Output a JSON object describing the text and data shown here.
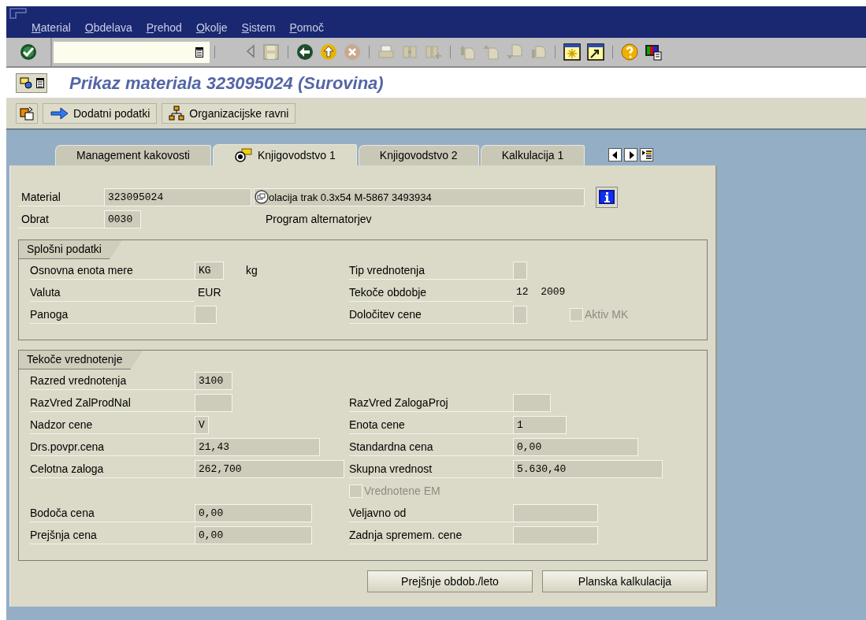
{
  "menu": [
    "Material",
    "Obdelava",
    "Prehod",
    "Okolje",
    "Sistem",
    "Pomoč"
  ],
  "title": "Prikaz materiala 323095024 (Surovina)",
  "app_toolbar": [
    {
      "label": "Dodatni podatki",
      "kind": "arrow"
    },
    {
      "label": "Organizacijske ravni",
      "kind": "hierarchy"
    }
  ],
  "tabs": [
    {
      "label": "Management kakovosti",
      "selected": false
    },
    {
      "label": "Knjigovodstvo 1",
      "selected": true
    },
    {
      "label": "Knjigovodstvo 2",
      "selected": false
    },
    {
      "label": "Kalkulacija 1",
      "selected": false
    }
  ],
  "header": [
    {
      "label": "Material",
      "value": "323095024",
      "description": "olacija trak 0.3x54 M-5867 3493934",
      "kind": "field"
    },
    {
      "label": "Obrat",
      "value": "0030",
      "description": "Program alternatorjev",
      "kind": "text"
    }
  ],
  "groups": [
    {
      "title": "Splošni podatki",
      "rows": [
        {
          "left": {
            "kind": "field",
            "label": "Osnovna enota mere",
            "value": "KG",
            "unit": "kg"
          },
          "right": {
            "kind": "field",
            "label": "Tip vrednotenja"
          }
        },
        {
          "left": {
            "kind": "text",
            "label": "Valuta",
            "value": "EUR"
          },
          "right": {
            "kind": "text",
            "label": "Tekoče obdobje",
            "value": "12  2009"
          }
        },
        {
          "left": {
            "kind": "field",
            "label": "Panoga"
          },
          "right": {
            "kind": "field",
            "label": "Določitev cene",
            "checkbox": {
              "label": "Aktiv MK",
              "checked": false,
              "disabled": true
            }
          }
        }
      ]
    },
    {
      "title": "Tekoče vrednotenje",
      "rows": [
        {
          "left": {
            "kind": "field",
            "label": "Razred vrednotenja",
            "value": "3100"
          }
        },
        {
          "left": {
            "kind": "field",
            "label": "RazVred ZalProdNal"
          },
          "right": {
            "kind": "field",
            "label": "RazVred ZalogaProj"
          }
        },
        {
          "left": {
            "kind": "field",
            "label": "Nadzor cene",
            "value": "V"
          },
          "right": {
            "kind": "field",
            "label": "Enota cene",
            "value": "1"
          }
        },
        {
          "left": {
            "kind": "field",
            "label": "Drs.povpr.cena",
            "value": "21,43"
          },
          "right": {
            "kind": "field",
            "label": "Standardna cena",
            "value": "0,00"
          }
        },
        {
          "left": {
            "kind": "field",
            "label": "Celotna zaloga",
            "value": "262,700"
          },
          "right": {
            "kind": "field",
            "label": "Skupna vrednost",
            "value": "5.630,40"
          }
        },
        {
          "right": {
            "kind": "checkbox",
            "label": "Vrednotene EM",
            "checked": false,
            "disabled": true
          }
        },
        {
          "left": {
            "kind": "field",
            "label": "Bodoča cena",
            "value": "0,00"
          },
          "right": {
            "kind": "field",
            "label": "Veljavno od"
          }
        },
        {
          "left": {
            "kind": "field",
            "label": "Prejšnja cena",
            "value": "0,00"
          },
          "right": {
            "kind": "field",
            "label": "Zadnja spremem. cene"
          }
        }
      ]
    }
  ],
  "buttons": [
    "Prejšnje obdob./leto",
    "Planska kalkulacija"
  ]
}
